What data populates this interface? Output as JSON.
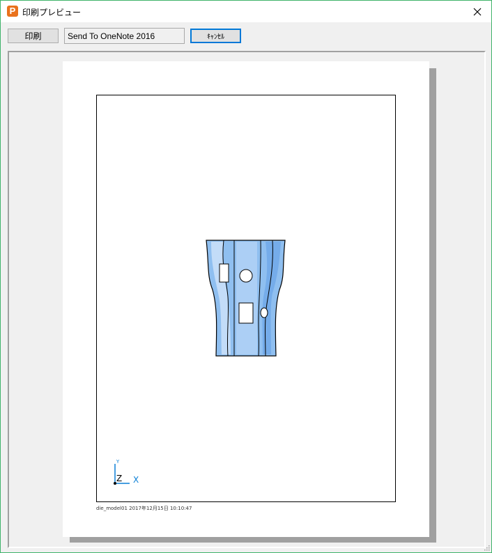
{
  "window": {
    "title": "印刷プレビュー",
    "app_icon_letter": "P"
  },
  "toolbar": {
    "print_label": "印刷",
    "printer_name": "Send To OneNote 2016",
    "cancel_label": "ｷｬﾝｾﾙ"
  },
  "preview": {
    "footer": "die_model01  2017年12月15日   10:10:47",
    "axis_labels": {
      "y": "Y",
      "z": "Z",
      "x": "X"
    }
  },
  "colors": {
    "accent": "#0078d7",
    "model_fill": "#8fbff0",
    "axis": "#0a7fd6"
  }
}
